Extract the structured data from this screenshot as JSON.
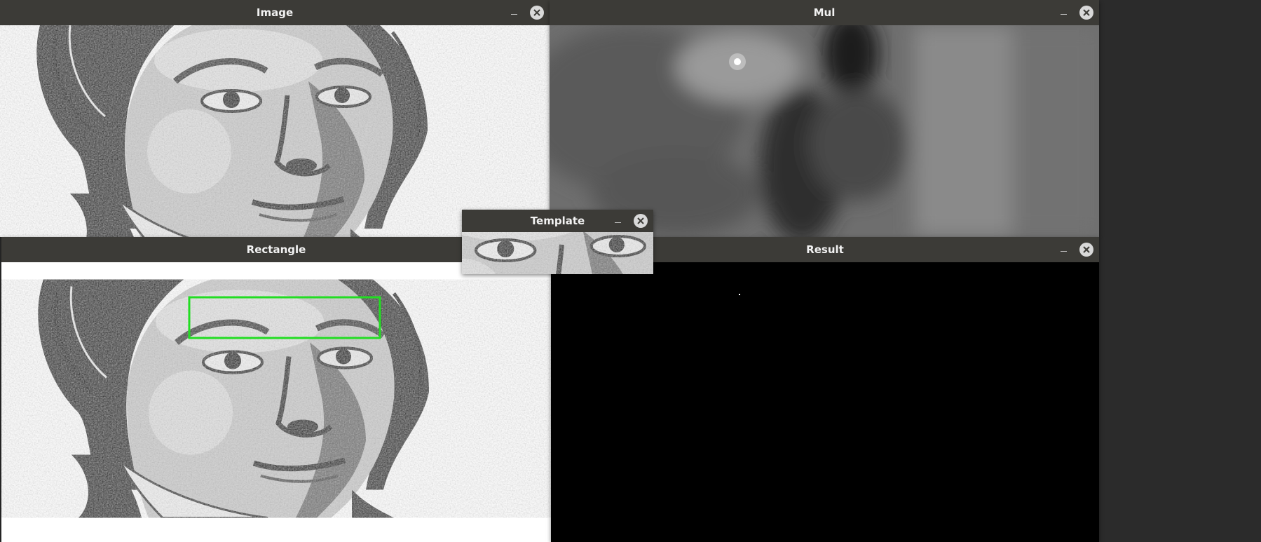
{
  "windows": {
    "image": {
      "title": "Image"
    },
    "mul": {
      "title": "Mul"
    },
    "rectangle": {
      "title": "Rectangle"
    },
    "result": {
      "title": "Result"
    },
    "template": {
      "title": "Template"
    }
  },
  "controls": {
    "minimize_icon": "minimize-icon",
    "close_icon": "close-icon"
  },
  "colors": {
    "titlebar": "#3c3b37",
    "detection_box": "#22dd22",
    "result_background": "#000000",
    "mul_background": "#6b6b6b"
  }
}
